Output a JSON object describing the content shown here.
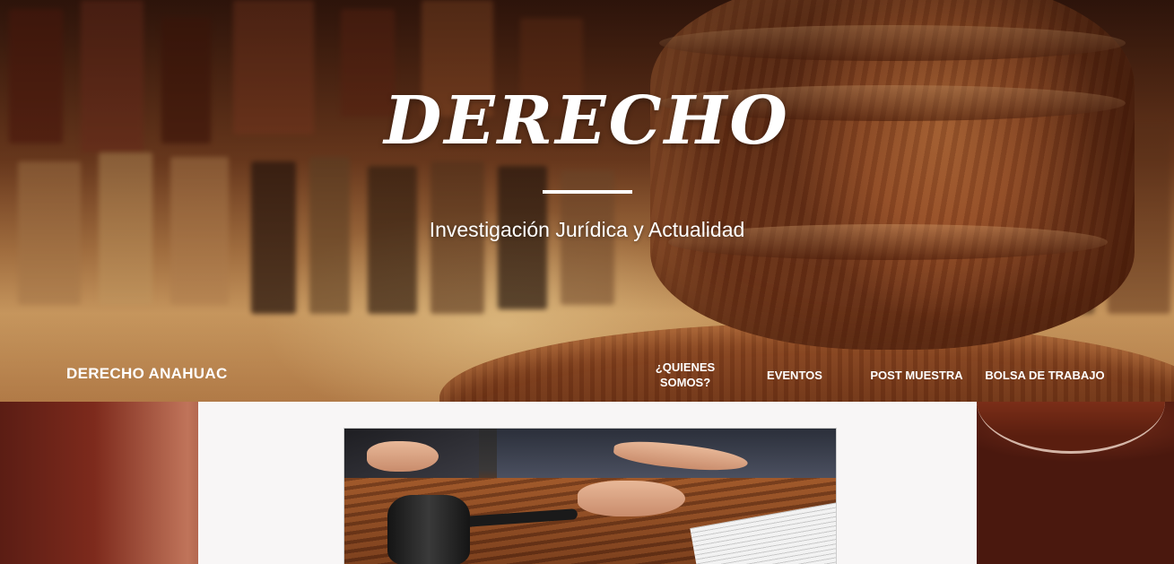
{
  "hero": {
    "title": "DERECHO",
    "tagline": "Investigación Jurídica y Actualidad"
  },
  "nav": {
    "brand": "DERECHO ANAHUAC",
    "items": [
      {
        "label": "¿QUIENES SOMOS?"
      },
      {
        "label": "EVENTOS"
      },
      {
        "label": "POST MUESTRA"
      },
      {
        "label": "BOLSA DE TRABAJO"
      }
    ]
  },
  "colors": {
    "nav_text": "#ffffff",
    "content_panel": "#f8f6f6"
  }
}
